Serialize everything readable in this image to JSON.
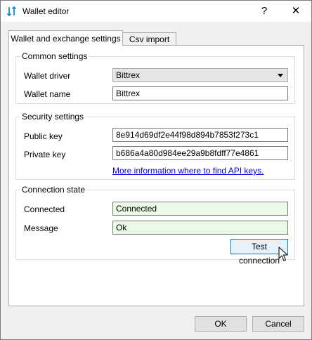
{
  "window": {
    "title": "Wallet editor",
    "help_label": "?",
    "close_label": "✕"
  },
  "tabs": [
    {
      "label": "Wallet and exchange settings",
      "active": true
    },
    {
      "label": "Csv import",
      "active": false
    }
  ],
  "common_settings": {
    "title": "Common settings",
    "wallet_driver_label": "Wallet driver",
    "wallet_driver_value": "Bittrex",
    "wallet_name_label": "Wallet name",
    "wallet_name_value": "Bittrex"
  },
  "security_settings": {
    "title": "Security settings",
    "public_key_label": "Public key",
    "public_key_value": "8e914d69df2e44f98d894b7853f273c1",
    "private_key_label": "Private key",
    "private_key_value": "b686a4a80d984ee29a9b8fdff77e4861",
    "api_link": "More information where to find API keys."
  },
  "connection_state": {
    "title": "Connection state",
    "connected_label": "Connected",
    "connected_value": "Connected",
    "message_label": "Message",
    "message_value": "Ok",
    "test_button": "Test connection"
  },
  "footer": {
    "ok_label": "OK",
    "cancel_label": "Cancel"
  },
  "colors": {
    "status_ok_bg": "#ebfae6",
    "link": "#0000ee",
    "focus_border": "#0078d7"
  }
}
